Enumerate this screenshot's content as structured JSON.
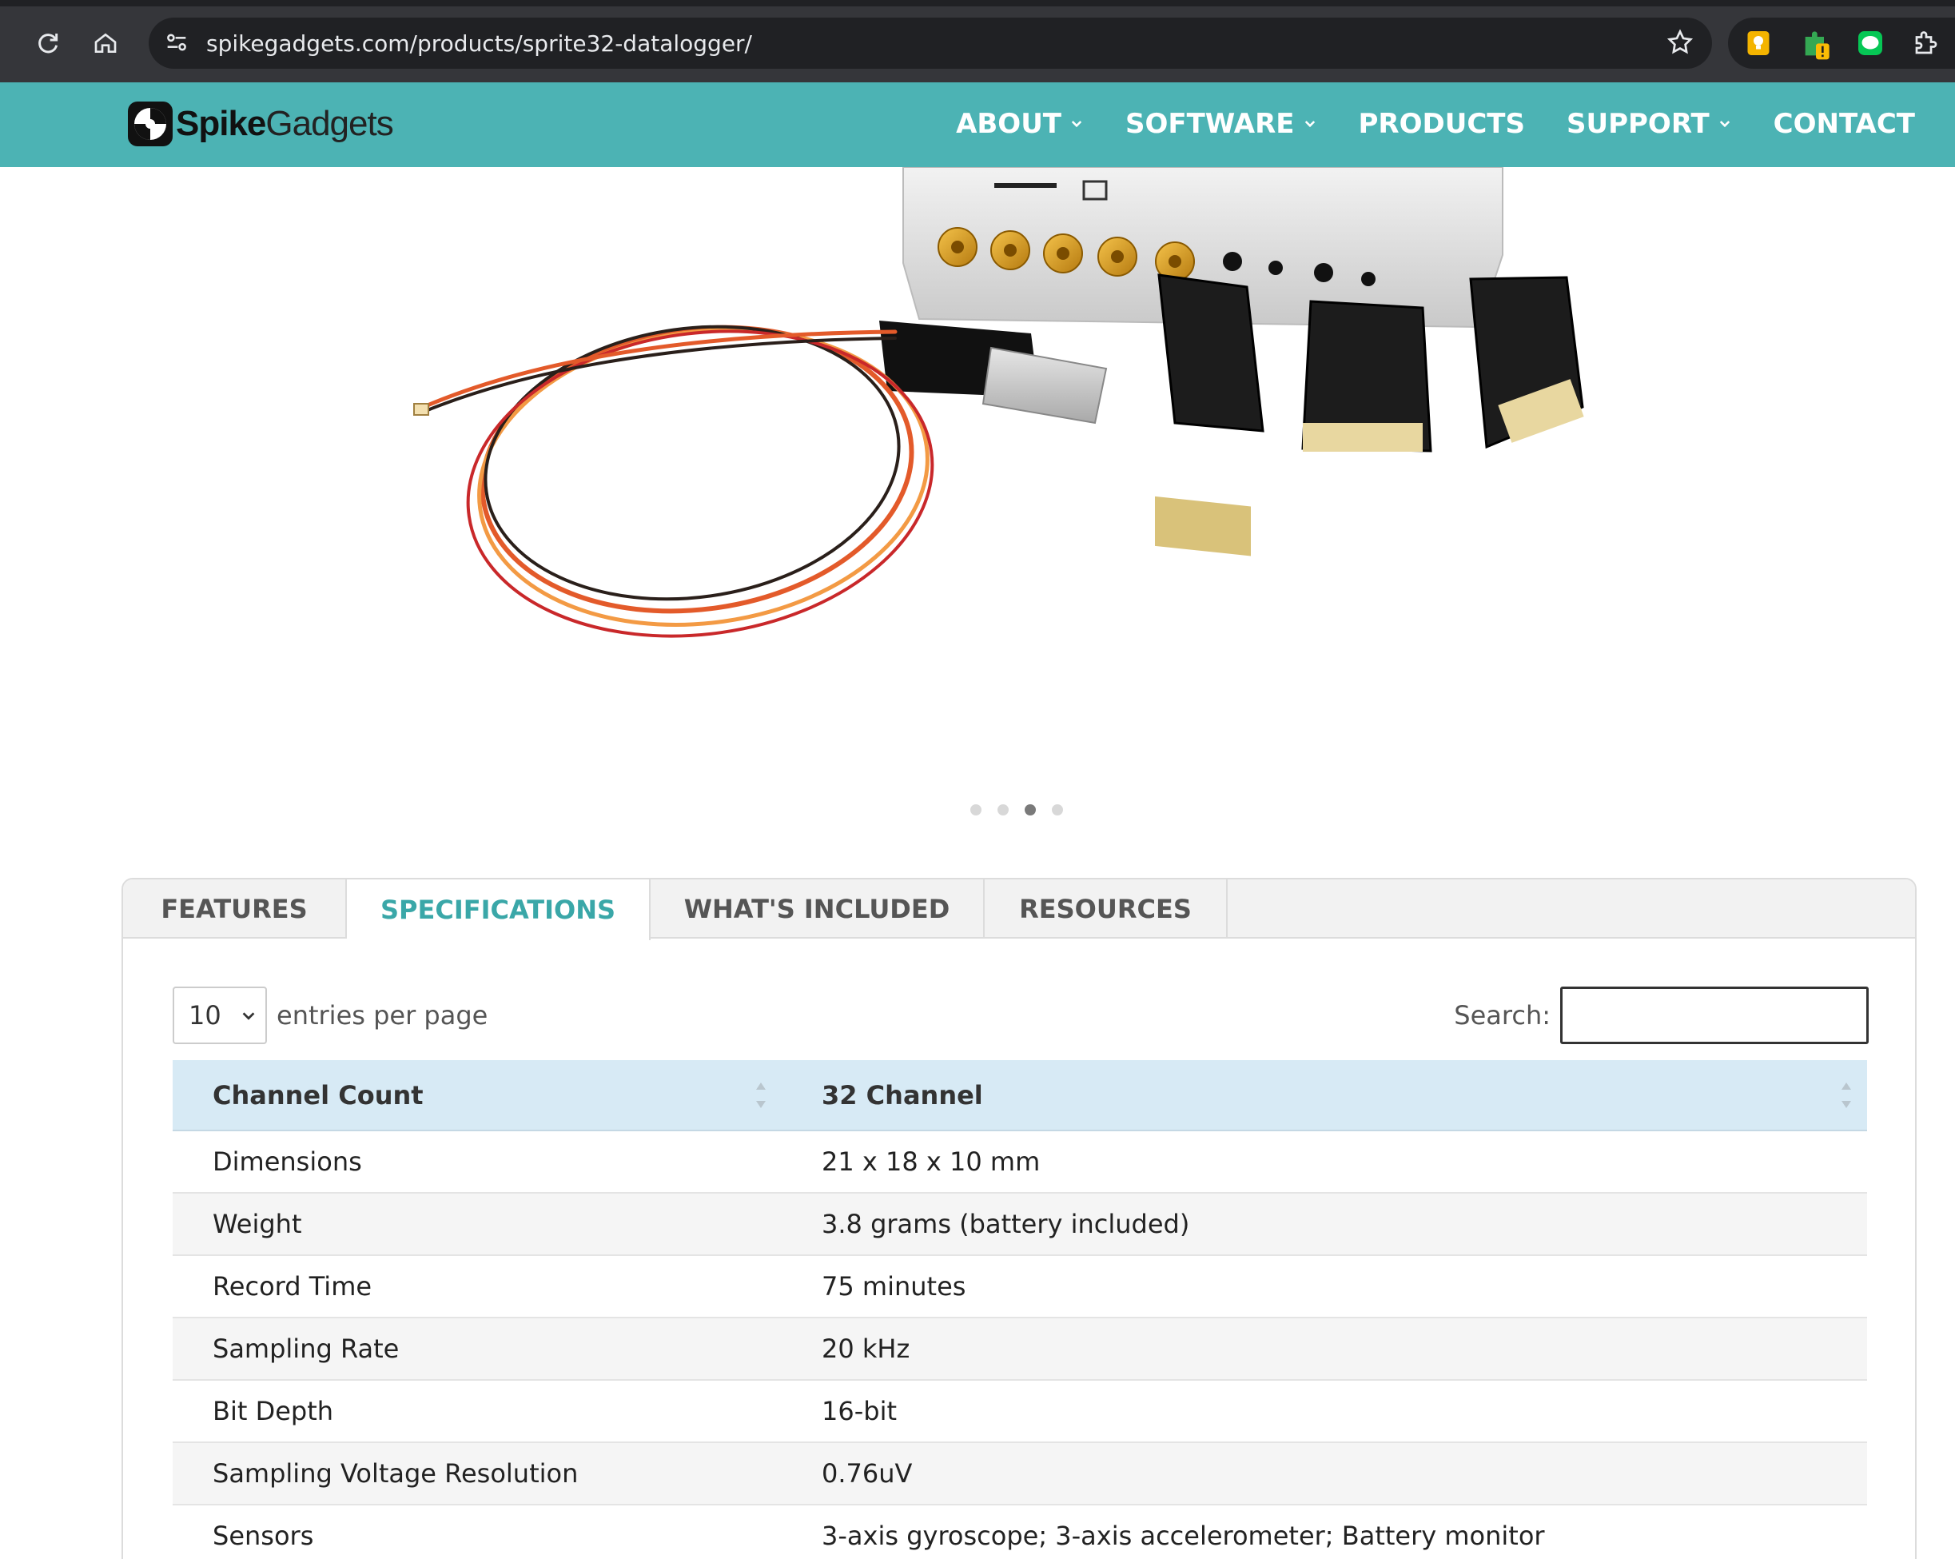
{
  "browser": {
    "url": "spikegadgets.com/products/sprite32-datalogger/"
  },
  "site": {
    "logo_bold": "Spike",
    "logo_light": "Gadgets",
    "nav": [
      {
        "label": "ABOUT",
        "has_dropdown": true
      },
      {
        "label": "SOFTWARE",
        "has_dropdown": true
      },
      {
        "label": "PRODUCTS",
        "has_dropdown": false
      },
      {
        "label": "SUPPORT",
        "has_dropdown": true
      },
      {
        "label": "CONTACT",
        "has_dropdown": false
      }
    ],
    "header_color": "#4cb3b4"
  },
  "carousel": {
    "slide_count": 4,
    "active_index": 2
  },
  "tabs": [
    {
      "label": "FEATURES",
      "active": false
    },
    {
      "label": "SPECIFICATIONS",
      "active": true
    },
    {
      "label": "WHAT'S INCLUDED",
      "active": false
    },
    {
      "label": "RESOURCES",
      "active": false
    }
  ],
  "table_controls": {
    "entries_value": "10",
    "entries_label": "entries per page",
    "search_label": "Search:",
    "search_value": ""
  },
  "spec_table": {
    "headers": [
      "Channel Count",
      "32 Channel"
    ],
    "rows": [
      [
        "Dimensions",
        "21 x 18 x 10 mm"
      ],
      [
        "Weight",
        "3.8 grams (battery included)"
      ],
      [
        "Record Time",
        "75 minutes"
      ],
      [
        "Sampling Rate",
        "20 kHz"
      ],
      [
        "Bit Depth",
        "16-bit"
      ],
      [
        "Sampling Voltage Resolution",
        "0.76uV"
      ],
      [
        "Sensors",
        "3-axis gyroscope; 3-axis accelerometer; Battery monitor"
      ]
    ]
  },
  "colors": {
    "accent": "#3aa7a8",
    "table_header": "#d7eaf5"
  }
}
